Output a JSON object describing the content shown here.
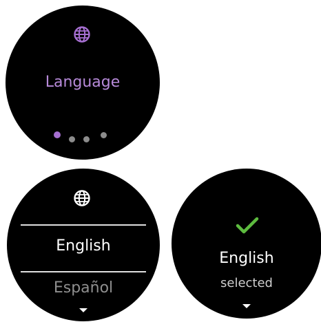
{
  "screens": {
    "menu": {
      "icon": "globe-icon",
      "title": "Language",
      "pager": {
        "page": 1,
        "total": 4
      }
    },
    "picker": {
      "icon": "globe-icon",
      "selected_option": "English",
      "next_option": "Español",
      "more_icon": "chevron-down-icon"
    },
    "confirmation": {
      "icon": "check-icon",
      "language": "English",
      "status": "selected",
      "more_icon": "chevron-down-icon"
    }
  },
  "colors": {
    "accent_purple": "#a66fd1",
    "success_green": "#5dbb3f",
    "screen_background": "#000000"
  }
}
